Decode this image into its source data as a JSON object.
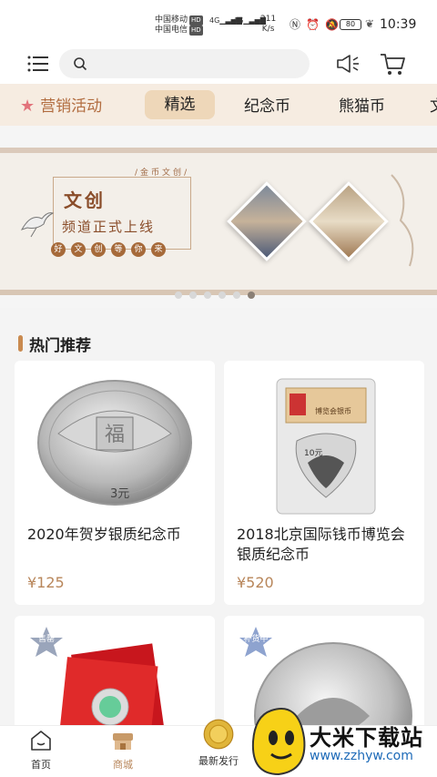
{
  "status_bar": {
    "carrier1": "中国移动",
    "carrier2": "中国电信",
    "hd": "HD",
    "net1": "4G",
    "net2": "4G",
    "speed": "211",
    "speed_unit": "K/s",
    "battery": "80",
    "time": "10:39"
  },
  "header": {
    "search_placeholder": ""
  },
  "tabs": {
    "promo": "营销活动",
    "items": [
      "精选",
      "纪念币",
      "熊猫币",
      "文"
    ]
  },
  "banner": {
    "subtitle": "金币文创",
    "title": "文创",
    "line": "频道正式上线",
    "slogan": [
      "好",
      "文",
      "创",
      "等",
      "你",
      "来"
    ],
    "dots": 6,
    "active_dot": 5
  },
  "section": {
    "title": "热门推荐"
  },
  "products": [
    {
      "name": "2020年贺岁银质纪念币",
      "price": "¥125",
      "badge": ""
    },
    {
      "name": "2018北京国际钱币博览会银质纪念币",
      "price": "¥520",
      "badge": ""
    },
    {
      "name": "",
      "price": "",
      "badge": "售罄"
    },
    {
      "name": "",
      "price": "",
      "badge": "补货中"
    }
  ],
  "coin_labels": {
    "coin1_value": "3元",
    "coin2_value": "10元",
    "slab_label": "博览会银币"
  },
  "bottom_nav": {
    "items": [
      "首页",
      "商城",
      "最新发行"
    ]
  },
  "watermark": {
    "name": "大米下载站",
    "url": "www.zzhyw.com"
  },
  "colors": {
    "accent": "#b8865a",
    "tab_bg": "#f6ece1",
    "tab_active": "#eed7b9",
    "promo_text": "#b26d40"
  }
}
